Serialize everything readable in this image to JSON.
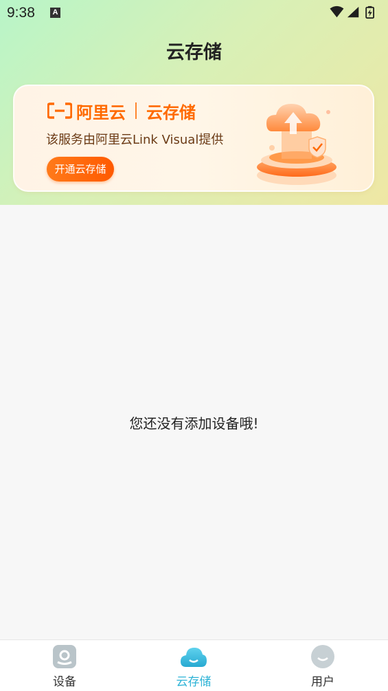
{
  "status_bar": {
    "time": "9:38"
  },
  "header": {
    "title": "云存储"
  },
  "banner": {
    "brand": "阿里云",
    "service": "云存储",
    "description": "该服务由阿里云Link Visual提供",
    "button_label": "开通云存储"
  },
  "empty_state": {
    "message": "您还没有添加设备哦!"
  },
  "tabbar": {
    "items": [
      {
        "label": "设备",
        "icon": "device-icon",
        "active": false
      },
      {
        "label": "云存储",
        "icon": "cloud-icon",
        "active": true
      },
      {
        "label": "用户",
        "icon": "user-icon",
        "active": false
      }
    ]
  },
  "colors": {
    "accent": "#ff6a00",
    "tab_active": "#2db3d6",
    "header_gradient_start": "#b8f5c8",
    "header_gradient_end": "#efe7a4"
  }
}
